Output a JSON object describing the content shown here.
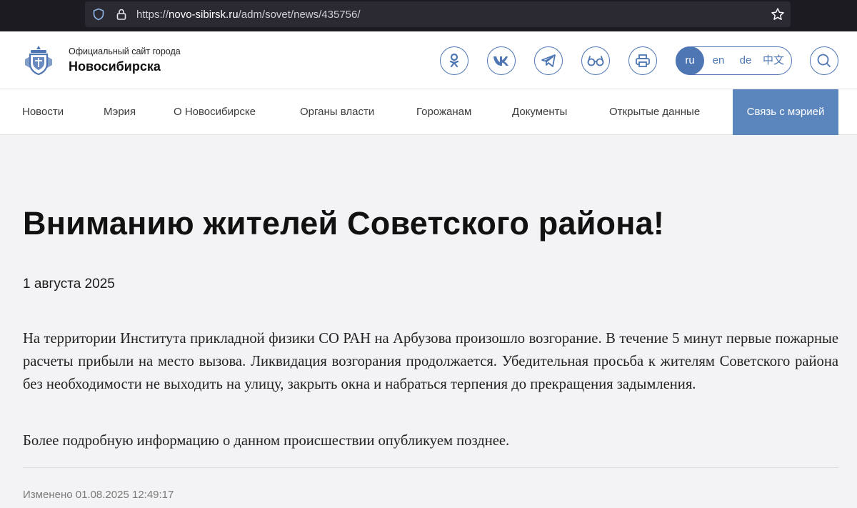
{
  "browser": {
    "url_prefix": "https://",
    "url_host": "novo-sibirsk.ru",
    "url_path": "/adm/sovet/news/435756/"
  },
  "header": {
    "subtitle": "Официальный сайт города",
    "city": "Новосибирска",
    "languages": [
      "ru",
      "en",
      "de",
      "中文"
    ],
    "active_language": "ru",
    "accent_color": "#4d76b3"
  },
  "nav": {
    "items": [
      "Новости",
      "Мэрия",
      "О Новосибирске",
      "Органы власти",
      "Горожанам",
      "Документы",
      "Открытые данные"
    ],
    "cta": "Связь с мэрией"
  },
  "article": {
    "title": "Вниманию жителей Советского района!",
    "date": "1 августа 2025",
    "paragraph_1": "На территории Института прикладной физики СО РАН на Арбузова произошло возгорание. В течение 5 минут первые пожарные расчеты прибыли на место вызова. Ликвидация возгорания продолжается. Убедительная просьба к жителям Советского района без необходимости не выходить на улицу, закрыть окна и набраться терпения до прекращения задымления.",
    "paragraph_2": "Более подробную информацию о данном происшествии опубликуем позднее.",
    "modified": "Изменено 01.08.2025 12:49:17"
  },
  "icons": [
    "shield-icon",
    "lock-icon",
    "star-icon",
    "city-logo",
    "odnoklassniki-icon",
    "vk-icon",
    "telegram-icon",
    "accessibility-glasses-icon",
    "print-icon",
    "search-icon"
  ]
}
